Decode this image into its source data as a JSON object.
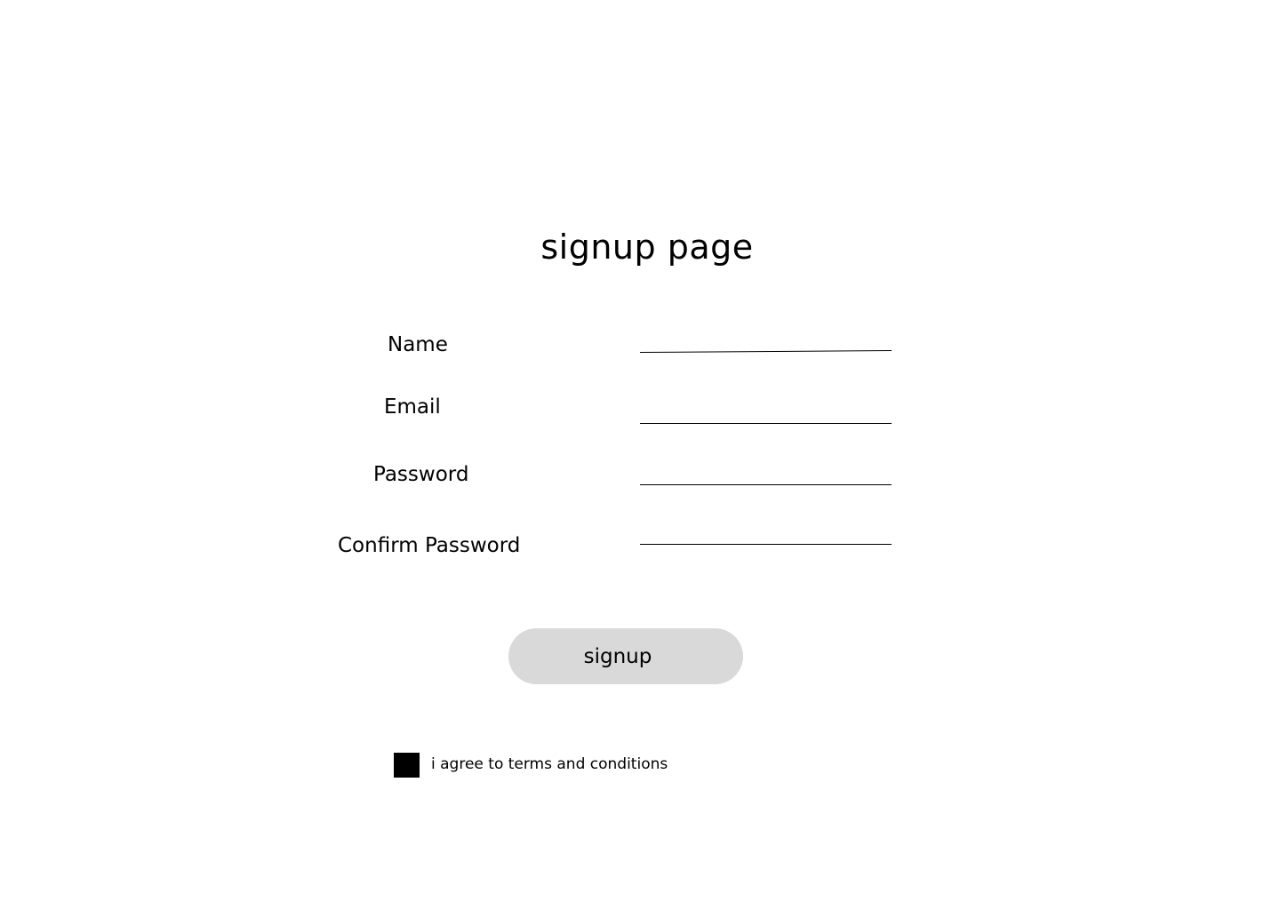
{
  "page": {
    "title": "signup page"
  },
  "form": {
    "fields": [
      {
        "label": "Name",
        "value": "",
        "placeholder": ""
      },
      {
        "label": "Email",
        "value": "",
        "placeholder": ""
      },
      {
        "label": "Password",
        "value": "",
        "placeholder": ""
      },
      {
        "label": "Confirm Password",
        "value": "",
        "placeholder": ""
      }
    ],
    "submit_label": "signup",
    "terms": {
      "label": "i agree to terms and conditions",
      "checked": true
    }
  },
  "colors": {
    "background": "#ffffff",
    "button": "#d9d9d9",
    "text": "#000000",
    "checkbox": "#000000"
  }
}
